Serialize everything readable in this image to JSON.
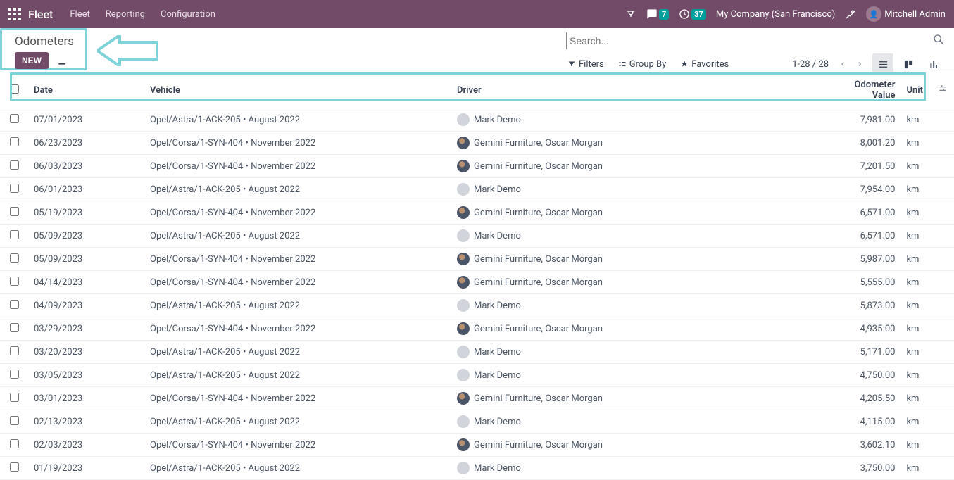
{
  "topnav": {
    "brand": "Fleet",
    "menu": [
      "Fleet",
      "Reporting",
      "Configuration"
    ],
    "chat_badge": "7",
    "clock_badge": "37",
    "company": "My Company (San Francisco)",
    "user": "Mitchell Admin"
  },
  "controls": {
    "page_title": "Odometers",
    "new_btn": "NEW",
    "search_placeholder": "Search...",
    "filters": "Filters",
    "groupby": "Group By",
    "favorites": "Favorites",
    "pager": "1-28 / 28"
  },
  "columns": {
    "date": "Date",
    "vehicle": "Vehicle",
    "driver": "Driver",
    "odometer": "Odometer Value",
    "unit": "Unit"
  },
  "rows": [
    {
      "date": "07/01/2023",
      "vehicle": "Opel/Astra/1-ACK-205 • August 2022",
      "driver": "Mark Demo",
      "photo": false,
      "odo": "7,981.00",
      "unit": "km"
    },
    {
      "date": "06/23/2023",
      "vehicle": "Opel/Corsa/1-SYN-404 • November 2022",
      "driver": "Gemini Furniture, Oscar Morgan",
      "photo": true,
      "odo": "8,001.20",
      "unit": "km"
    },
    {
      "date": "06/03/2023",
      "vehicle": "Opel/Corsa/1-SYN-404 • November 2022",
      "driver": "Gemini Furniture, Oscar Morgan",
      "photo": true,
      "odo": "7,201.50",
      "unit": "km"
    },
    {
      "date": "06/01/2023",
      "vehicle": "Opel/Astra/1-ACK-205 • August 2022",
      "driver": "Mark Demo",
      "photo": false,
      "odo": "7,954.00",
      "unit": "km"
    },
    {
      "date": "05/19/2023",
      "vehicle": "Opel/Corsa/1-SYN-404 • November 2022",
      "driver": "Gemini Furniture, Oscar Morgan",
      "photo": true,
      "odo": "6,571.00",
      "unit": "km"
    },
    {
      "date": "05/09/2023",
      "vehicle": "Opel/Astra/1-ACK-205 • August 2022",
      "driver": "Mark Demo",
      "photo": false,
      "odo": "6,571.00",
      "unit": "km"
    },
    {
      "date": "05/09/2023",
      "vehicle": "Opel/Corsa/1-SYN-404 • November 2022",
      "driver": "Gemini Furniture, Oscar Morgan",
      "photo": true,
      "odo": "5,987.00",
      "unit": "km"
    },
    {
      "date": "04/14/2023",
      "vehicle": "Opel/Corsa/1-SYN-404 • November 2022",
      "driver": "Gemini Furniture, Oscar Morgan",
      "photo": true,
      "odo": "5,555.00",
      "unit": "km"
    },
    {
      "date": "04/09/2023",
      "vehicle": "Opel/Astra/1-ACK-205 • August 2022",
      "driver": "Mark Demo",
      "photo": false,
      "odo": "5,873.00",
      "unit": "km"
    },
    {
      "date": "03/29/2023",
      "vehicle": "Opel/Corsa/1-SYN-404 • November 2022",
      "driver": "Gemini Furniture, Oscar Morgan",
      "photo": true,
      "odo": "4,935.00",
      "unit": "km"
    },
    {
      "date": "03/20/2023",
      "vehicle": "Opel/Astra/1-ACK-205 • August 2022",
      "driver": "Mark Demo",
      "photo": false,
      "odo": "5,171.00",
      "unit": "km"
    },
    {
      "date": "03/05/2023",
      "vehicle": "Opel/Astra/1-ACK-205 • August 2022",
      "driver": "Mark Demo",
      "photo": false,
      "odo": "4,750.00",
      "unit": "km"
    },
    {
      "date": "03/01/2023",
      "vehicle": "Opel/Corsa/1-SYN-404 • November 2022",
      "driver": "Gemini Furniture, Oscar Morgan",
      "photo": true,
      "odo": "4,205.50",
      "unit": "km"
    },
    {
      "date": "02/13/2023",
      "vehicle": "Opel/Astra/1-ACK-205 • August 2022",
      "driver": "Mark Demo",
      "photo": false,
      "odo": "4,115.00",
      "unit": "km"
    },
    {
      "date": "02/03/2023",
      "vehicle": "Opel/Corsa/1-SYN-404 • November 2022",
      "driver": "Gemini Furniture, Oscar Morgan",
      "photo": true,
      "odo": "3,602.10",
      "unit": "km"
    },
    {
      "date": "01/19/2023",
      "vehicle": "Opel/Astra/1-ACK-205 • August 2022",
      "driver": "Mark Demo",
      "photo": false,
      "odo": "3,750.00",
      "unit": "km"
    }
  ]
}
